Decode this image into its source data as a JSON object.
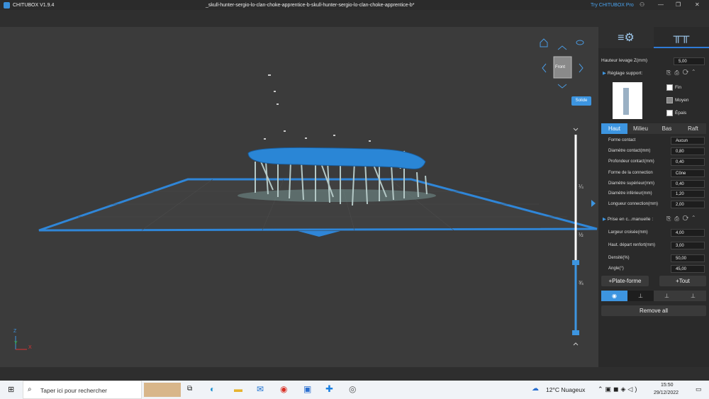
{
  "window": {
    "app_title": "CHITUBOX V1.9.4",
    "document_title": "_skull-hunter-sergio-lo-clan-choke-apprentice-b-skull-hunter-sergio-lo-clan-choke-apprentice-b*",
    "pro_link": "Try CHITUBOX Pro"
  },
  "viewport": {
    "view_label": "Front",
    "solid_label": "Solide",
    "slider_quarter": "¼",
    "slider_half": "½",
    "slider_three_quarter": "¾",
    "axis_x": "X",
    "axis_y": "Y",
    "axis_z": "Z"
  },
  "panel": {
    "lift_label": "Hauteur levage Z(mm)",
    "lift_value": "5,00",
    "support_settings": "Réglage support:",
    "density_options": [
      "Fin",
      "Moyen",
      "Épais"
    ],
    "tabs": [
      "Haut",
      "Milieu",
      "Bas",
      "Raft"
    ],
    "params": [
      {
        "label": "Forme contact",
        "value": "Aucun"
      },
      {
        "label": "Diamètre contact(mm)",
        "value": "0,80"
      },
      {
        "label": "Profondeur contact(mm)",
        "value": "0,40"
      },
      {
        "label": "Forme de la connection",
        "value": "Cône"
      },
      {
        "label": "Diamètre supérieur(mm)",
        "value": "0,40"
      },
      {
        "label": "Diamètre inférieur(mm)",
        "value": "1,20"
      },
      {
        "label": "Longueur connection(mm)",
        "value": "2,00"
      }
    ],
    "manual_label": "Prise en c...manuelle :",
    "params2": [
      {
        "label": "Largeur croisée(mm)",
        "value": "4,00"
      },
      {
        "label": "Haut. départ renfort(mm)",
        "value": "3,00"
      },
      {
        "label": "Densité(%)",
        "value": "50,00"
      },
      {
        "label": "Angle(°)",
        "value": "45,00"
      }
    ],
    "add_platform": "+Plate-forme",
    "add_all": "+Tout",
    "remove_all": "Remove all"
  },
  "taskbar": {
    "search_placeholder": "Taper ici pour rechercher",
    "weather": "12°C  Nuageux",
    "time": "15:50",
    "date": "29/12/2022"
  },
  "colors": {
    "accent": "#3d95e0",
    "model": "#2a86d6",
    "support": "#b4c8c6"
  }
}
